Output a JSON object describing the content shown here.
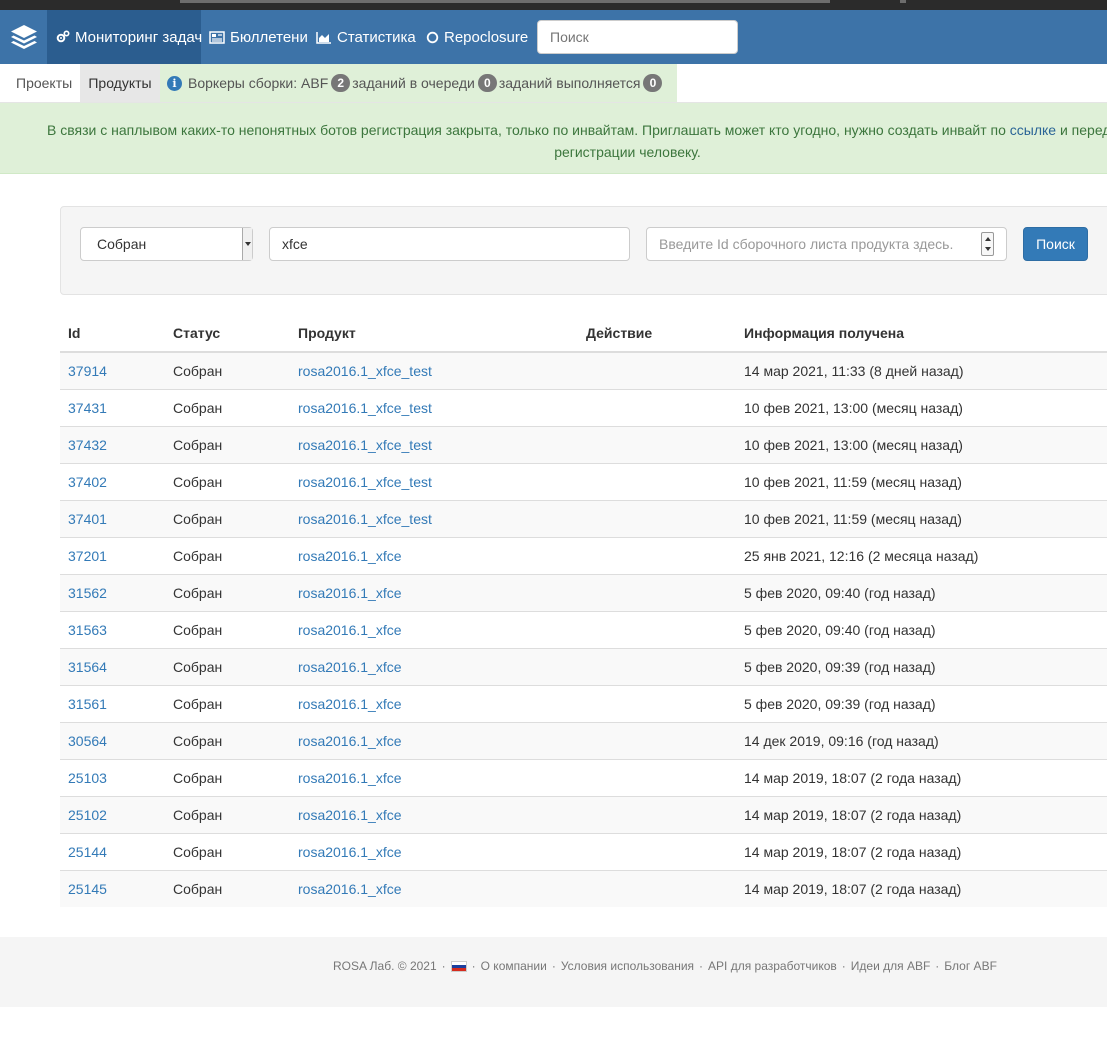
{
  "navbar": {
    "items": [
      {
        "label": "Мониторинг задач",
        "icon": "gears-icon",
        "active": true
      },
      {
        "label": "Бюллетени",
        "icon": "newspaper-icon"
      },
      {
        "label": "Статистика",
        "icon": "area-chart-icon"
      },
      {
        "label": "Repoclosure",
        "icon": "circle-icon"
      }
    ],
    "search_placeholder": "Поиск"
  },
  "subnav": {
    "projects": "Проекты",
    "products": "Продукты",
    "workers_label": "Воркеры сборки: ABF",
    "workers_count": "2",
    "queued_label": "заданий в очереди",
    "queued_count": "0",
    "running_label": "заданий выполняется",
    "running_count": "0"
  },
  "alert": {
    "text_before": "В связи с наплывом каких-то непонятных ботов регистрация закрыта, только по инвайтам. Приглашать может кто угодно, нужно создать инвайт по ",
    "link": "ссылке",
    "text_after": " и передать",
    "line2": "регистрации человеку."
  },
  "filter": {
    "status_value": "Собран",
    "search_value": "xfce",
    "id_placeholder": "Введите Id сборочного листа продукта здесь.",
    "search_button": "Поиск"
  },
  "table": {
    "headers": [
      "Id",
      "Статус",
      "Продукт",
      "Действие",
      "Информация получена"
    ],
    "rows": [
      {
        "id": "37914",
        "status": "Собран",
        "product": "rosa2016.1_xfce_test",
        "action": "",
        "info": "14 мар 2021, 11:33 (8 дней назад)"
      },
      {
        "id": "37431",
        "status": "Собран",
        "product": "rosa2016.1_xfce_test",
        "action": "",
        "info": "10 фев 2021, 13:00 (месяц назад)"
      },
      {
        "id": "37432",
        "status": "Собран",
        "product": "rosa2016.1_xfce_test",
        "action": "",
        "info": "10 фев 2021, 13:00 (месяц назад)"
      },
      {
        "id": "37402",
        "status": "Собран",
        "product": "rosa2016.1_xfce_test",
        "action": "",
        "info": "10 фев 2021, 11:59 (месяц назад)"
      },
      {
        "id": "37401",
        "status": "Собран",
        "product": "rosa2016.1_xfce_test",
        "action": "",
        "info": "10 фев 2021, 11:59 (месяц назад)"
      },
      {
        "id": "37201",
        "status": "Собран",
        "product": "rosa2016.1_xfce",
        "action": "",
        "info": "25 янв 2021, 12:16 (2 месяца назад)"
      },
      {
        "id": "31562",
        "status": "Собран",
        "product": "rosa2016.1_xfce",
        "action": "",
        "info": "5 фев 2020, 09:40 (год назад)"
      },
      {
        "id": "31563",
        "status": "Собран",
        "product": "rosa2016.1_xfce",
        "action": "",
        "info": "5 фев 2020, 09:40 (год назад)"
      },
      {
        "id": "31564",
        "status": "Собран",
        "product": "rosa2016.1_xfce",
        "action": "",
        "info": "5 фев 2020, 09:39 (год назад)"
      },
      {
        "id": "31561",
        "status": "Собран",
        "product": "rosa2016.1_xfce",
        "action": "",
        "info": "5 фев 2020, 09:39 (год назад)"
      },
      {
        "id": "30564",
        "status": "Собран",
        "product": "rosa2016.1_xfce",
        "action": "",
        "info": "14 дек 2019, 09:16 (год назад)"
      },
      {
        "id": "25103",
        "status": "Собран",
        "product": "rosa2016.1_xfce",
        "action": "",
        "info": "14 мар 2019, 18:07 (2 года назад)"
      },
      {
        "id": "25102",
        "status": "Собран",
        "product": "rosa2016.1_xfce",
        "action": "",
        "info": "14 мар 2019, 18:07 (2 года назад)"
      },
      {
        "id": "25144",
        "status": "Собран",
        "product": "rosa2016.1_xfce",
        "action": "",
        "info": "14 мар 2019, 18:07 (2 года назад)"
      },
      {
        "id": "25145",
        "status": "Собран",
        "product": "rosa2016.1_xfce",
        "action": "",
        "info": "14 мар 2019, 18:07 (2 года назад)"
      }
    ]
  },
  "footer": {
    "copyright": "ROSA Лаб. © 2021",
    "separator": "·",
    "links": [
      "О компании",
      "Условия использования",
      "API для разработчиков",
      "Идеи для ABF",
      "Блог ABF"
    ]
  },
  "colors": {
    "navbar": "#3d73a8",
    "navbar_active": "#2b5d8f",
    "link": "#337ab7",
    "alert_bg": "#dff0d8",
    "alert_text": "#3c763d"
  }
}
